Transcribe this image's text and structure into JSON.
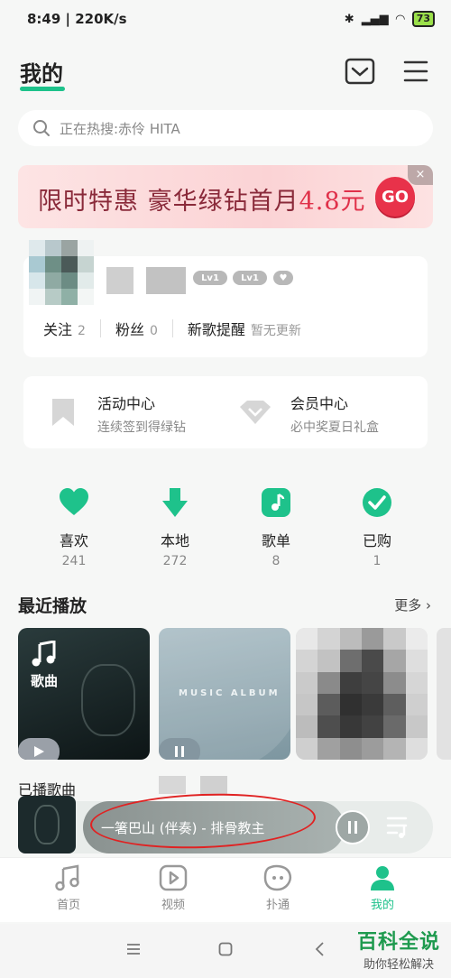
{
  "status_bar": {
    "time": "8:49 | 220K/s",
    "battery": "73"
  },
  "header": {
    "title": "我的"
  },
  "search": {
    "placeholder": "正在热搜:赤伶 HITA"
  },
  "banner": {
    "text_a": "限时特惠 豪华绿钻首月",
    "text_price": "4.8元",
    "go": "GO",
    "close": "×"
  },
  "profile": {
    "follow_label": "关注",
    "follow_count": "2",
    "fans_label": "粉丝",
    "fans_count": "0",
    "new_songs_label": "新歌提醒",
    "new_songs_status": "暂无更新",
    "badge1": "Lv1",
    "badge2": "Lv1"
  },
  "activity": {
    "left_title": "活动中心",
    "left_sub": "连续签到得绿钻",
    "right_title": "会员中心",
    "right_sub": "必中奖夏日礼盒"
  },
  "quick": [
    {
      "label": "喜欢",
      "count": "241",
      "icon": "heart-icon"
    },
    {
      "label": "本地",
      "count": "272",
      "icon": "download-icon"
    },
    {
      "label": "歌单",
      "count": "8",
      "icon": "music-note-icon"
    },
    {
      "label": "已购",
      "count": "1",
      "icon": "check-icon"
    }
  ],
  "recent": {
    "title": "最近播放",
    "more": "更多",
    "card1_tag": "歌曲",
    "card1_label": "已播歌曲",
    "card2_text": "MUSIC ALBUM"
  },
  "player": {
    "track": "一箸巴山 (伴奏) - 排骨教主"
  },
  "nav": [
    {
      "label": "首页",
      "icon": "music-home-icon"
    },
    {
      "label": "视频",
      "icon": "video-play-icon"
    },
    {
      "label": "扑通",
      "icon": "face-icon"
    },
    {
      "label": "我的",
      "icon": "person-icon"
    }
  ],
  "watermark": {
    "big": "百科全说",
    "small": "助你轻松解决"
  },
  "colors": {
    "accent": "#1ec28b",
    "banner_red": "#e8324a"
  }
}
